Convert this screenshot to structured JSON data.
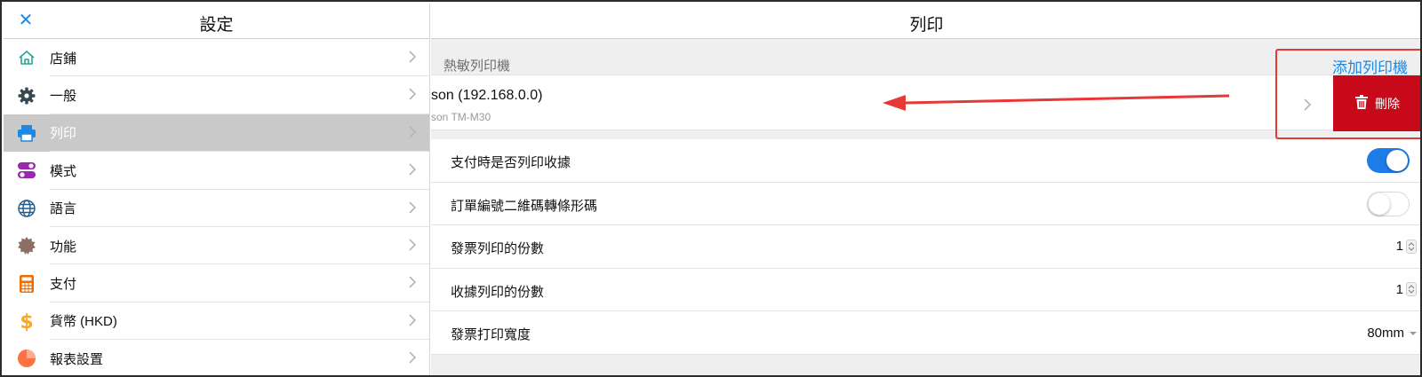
{
  "sidebar": {
    "title": "設定",
    "items": [
      {
        "label": "店鋪",
        "icon": "home-icon",
        "color": "#26a69a"
      },
      {
        "label": "一般",
        "icon": "gear-icon",
        "color": "#37474f"
      },
      {
        "label": "列印",
        "icon": "printer-icon",
        "color": "#1e88e5",
        "active": true
      },
      {
        "label": "模式",
        "icon": "toggles-icon",
        "color": "#9c27b0"
      },
      {
        "label": "語言",
        "icon": "globe-icon",
        "color": "#1e5a8c"
      },
      {
        "label": "功能",
        "icon": "badge-icon",
        "color": "#8d6e63"
      },
      {
        "label": "支付",
        "icon": "calculator-icon",
        "color": "#ef6c00"
      },
      {
        "label": "貨幣 (HKD)",
        "icon": "dollar-icon",
        "color": "#f9a825"
      },
      {
        "label": "報表設置",
        "icon": "pie-chart-icon",
        "color": "#ff7043"
      }
    ]
  },
  "main": {
    "title": "列印",
    "section_label": "熱敏列印機",
    "add_printer_label": "添加列印機",
    "printer": {
      "name": "son (192.168.0.0)",
      "model": "son TM-M30"
    },
    "delete_label": "刪除",
    "settings": [
      {
        "label": "支付時是否列印收據",
        "control": "toggle",
        "value": "on"
      },
      {
        "label": "訂單編號二維碼轉條形碼",
        "control": "toggle",
        "value": "off"
      },
      {
        "label": "發票列印的份數",
        "control": "stepper",
        "value": "1"
      },
      {
        "label": "收據列印的份數",
        "control": "stepper",
        "value": "1"
      },
      {
        "label": "發票打印寬度",
        "control": "select",
        "value": "80mm"
      }
    ]
  },
  "colors": {
    "accent": "#1e88e5",
    "toggle_on": "#1e7ce8",
    "delete": "#c8091a",
    "annotation": "#e53935"
  }
}
